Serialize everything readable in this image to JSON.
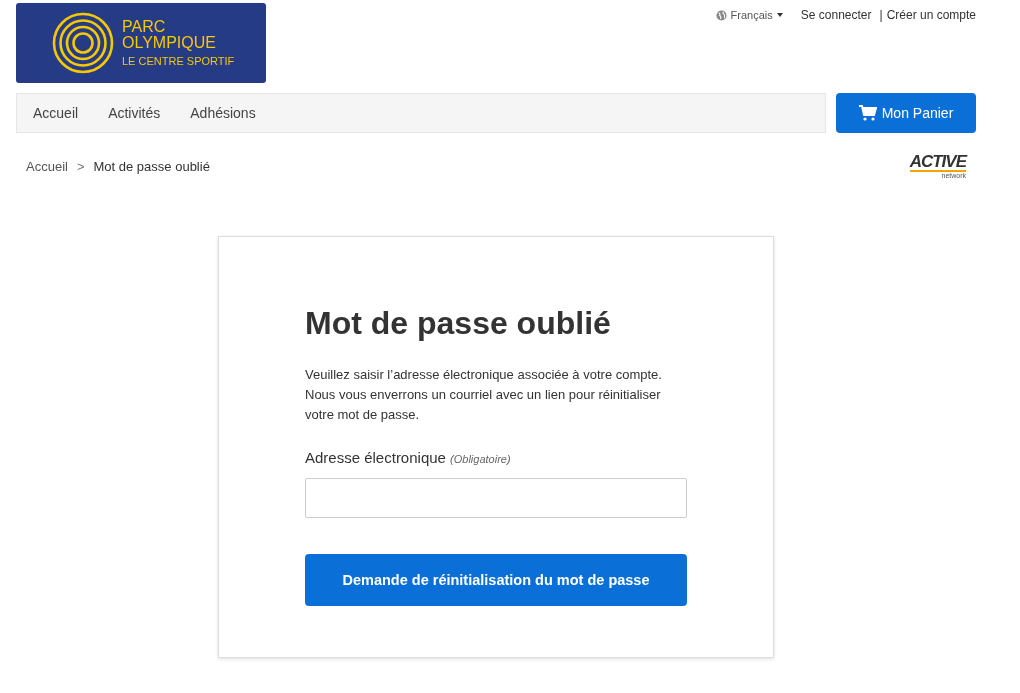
{
  "logo": {
    "line_1": "PARC",
    "line_2": "OLYMPIQUE",
    "line_3": "LE CENTRE SPORTIF"
  },
  "top_links": {
    "language": "Français",
    "sign_in": "Se connecter",
    "separator": "|",
    "create_account": "Créer un compte"
  },
  "nav": {
    "items": [
      {
        "label": "Accueil"
      },
      {
        "label": "Activités"
      },
      {
        "label": "Adhésions"
      }
    ],
    "cart_button": "Mon Panier"
  },
  "breadcrumb": {
    "items": [
      {
        "label": "Accueil"
      },
      {
        "label": "Mot de passe oublié"
      }
    ],
    "separator": ">"
  },
  "brand": {
    "name": "ACTIVE",
    "sub": "network"
  },
  "form": {
    "title": "Mot de passe oublié",
    "description": "Veuillez saisir l’adresse électronique associée à votre compte. Nous vous enverrons un courriel avec un lien pour réinitialiser votre mot de passe.",
    "field_label": "Adresse électronique",
    "field_hint": "(Obligatoire)",
    "submit": "Demande de réinitialisation du mot de passe"
  }
}
